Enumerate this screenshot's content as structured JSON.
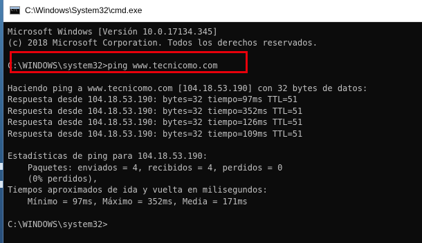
{
  "window": {
    "title": "C:\\Windows\\System32\\cmd.exe",
    "icon": "cmd-icon"
  },
  "console": {
    "lines": [
      "Microsoft Windows [Versión 10.0.17134.345]",
      "(c) 2018 Microsoft Corporation. Todos los derechos reservados.",
      "",
      "C:\\WINDOWS\\system32>ping www.tecnicomo.com",
      "",
      "Haciendo ping a www.tecnicomo.com [104.18.53.190] con 32 bytes de datos:",
      "Respuesta desde 104.18.53.190: bytes=32 tiempo=97ms TTL=51",
      "Respuesta desde 104.18.53.190: bytes=32 tiempo=352ms TTL=51",
      "Respuesta desde 104.18.53.190: bytes=32 tiempo=126ms TTL=51",
      "Respuesta desde 104.18.53.190: bytes=32 tiempo=109ms TTL=51",
      "",
      "Estadísticas de ping para 104.18.53.190:",
      "    Paquetes: enviados = 4, recibidos = 4, perdidos = 0",
      "    (0% perdidos),",
      "Tiempos aproximados de ida y vuelta en milisegundos:",
      "    Mínimo = 97ms, Máximo = 352ms, Media = 171ms",
      "",
      "C:\\WINDOWS\\system32>"
    ]
  },
  "colors": {
    "console_bg": "#0c0c0c",
    "console_text": "#c0c0c0",
    "highlight": "#e8000b"
  }
}
